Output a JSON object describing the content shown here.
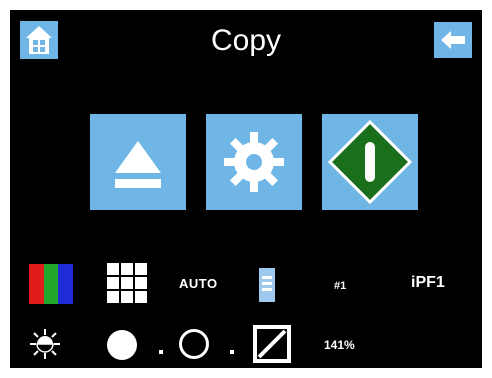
{
  "header": {
    "title": "Copy",
    "home_icon": "home-icon",
    "back_icon": "back-arrow-icon"
  },
  "actions": {
    "eject_icon": "eject-icon",
    "settings_icon": "gear-icon",
    "start_icon": "start-diamond-icon"
  },
  "status": {
    "color_mode_icon": "rgb-color-icon",
    "layout_icon": "grid-icon",
    "paper_source": "AUTO",
    "tray_icon": "paper-tray-icon",
    "tray_number": "#1",
    "printer_name": "iPF1"
  },
  "adjustments": {
    "brightness_icon": "brightness-icon",
    "density_dark_icon": "filled-dot-icon",
    "density_light_icon": "open-dot-icon",
    "ratio_icon": "reduce-enlarge-icon",
    "zoom": "141%"
  },
  "colors": {
    "button_blue": "#6fb5e6",
    "background": "#000000",
    "start_green": "#1a6f1a",
    "text": "#ffffff"
  }
}
